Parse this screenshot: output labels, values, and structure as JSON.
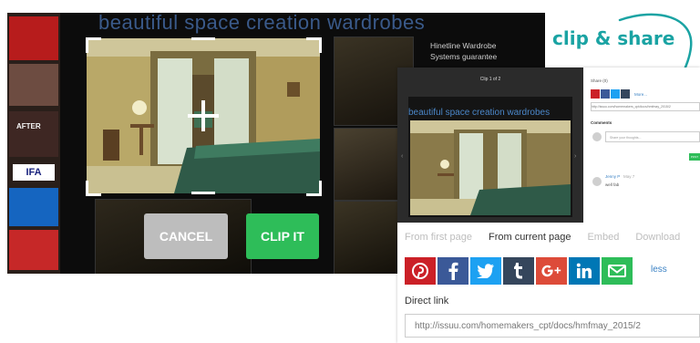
{
  "left": {
    "title": "beautiful space creation wardrobes",
    "side_lines": [
      "Hinetline Wardrobe",
      "Systems guarantee"
    ],
    "ad_after": "AFTER",
    "ad_logo": "IFA",
    "cancel_label": "CANCEL",
    "clip_label": "CLIP IT"
  },
  "annotation": "clip & share",
  "viewer": {
    "caption": "Clip 1 of 2",
    "title": "beautiful space creation wardrobes"
  },
  "mini": {
    "share_label": "Share (0)",
    "more": "More...",
    "link": "http://issuu.com/homemakers_cpt/docs/hmfmay_2015/2",
    "comments_label": "Comments",
    "comment_placeholder": "Share your thoughts...",
    "post_label": "POST",
    "commenter": "Jenny P",
    "comment_date": "May 7",
    "comment_text": "well fab"
  },
  "tabs": [
    {
      "label": "From first page",
      "active": false
    },
    {
      "label": "From current page",
      "active": true
    },
    {
      "label": "Embed",
      "active": false
    },
    {
      "label": "Download",
      "active": false
    }
  ],
  "share_icons": [
    {
      "name": "pinterest-icon",
      "color": "#cb2027"
    },
    {
      "name": "facebook-icon",
      "color": "#3b5998"
    },
    {
      "name": "twitter-icon",
      "color": "#1da1f2"
    },
    {
      "name": "tumblr-icon",
      "color": "#35465c"
    },
    {
      "name": "google-plus-icon",
      "color": "#dd4b39"
    },
    {
      "name": "linkedin-icon",
      "color": "#0077b5"
    },
    {
      "name": "email-icon",
      "color": "#2ebd59"
    }
  ],
  "less_label": "less",
  "direct_link_label": "Direct link",
  "direct_link_value": "http://issuu.com/homemakers_cpt/docs/hmfmay_2015/2"
}
